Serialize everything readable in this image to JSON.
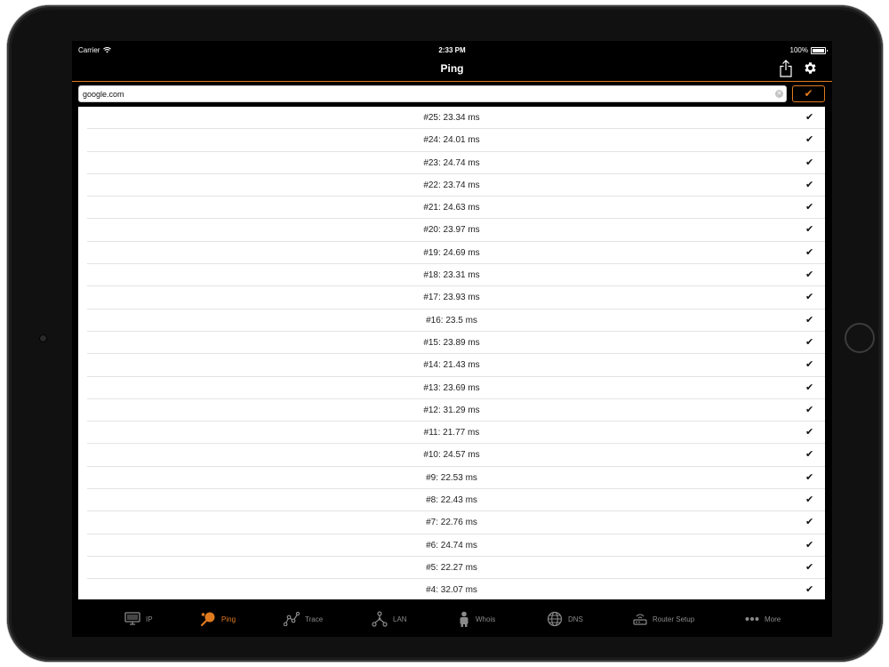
{
  "status": {
    "carrier": "Carrier",
    "time": "2:33 PM",
    "battery": "100%"
  },
  "nav": {
    "title": "Ping"
  },
  "search": {
    "value": "google.com"
  },
  "go_button": {
    "label": "✔"
  },
  "results": [
    {
      "label": "#25: 23.34 ms",
      "check": "✔"
    },
    {
      "label": "#24: 24.01 ms",
      "check": "✔"
    },
    {
      "label": "#23: 24.74 ms",
      "check": "✔"
    },
    {
      "label": "#22: 23.74 ms",
      "check": "✔"
    },
    {
      "label": "#21: 24.63 ms",
      "check": "✔"
    },
    {
      "label": "#20: 23.97 ms",
      "check": "✔"
    },
    {
      "label": "#19: 24.69 ms",
      "check": "✔"
    },
    {
      "label": "#18: 23.31 ms",
      "check": "✔"
    },
    {
      "label": "#17: 23.93 ms",
      "check": "✔"
    },
    {
      "label": "#16: 23.5 ms",
      "check": "✔"
    },
    {
      "label": "#15: 23.89 ms",
      "check": "✔"
    },
    {
      "label": "#14: 21.43 ms",
      "check": "✔"
    },
    {
      "label": "#13: 23.69 ms",
      "check": "✔"
    },
    {
      "label": "#12: 31.29 ms",
      "check": "✔"
    },
    {
      "label": "#11: 21.77 ms",
      "check": "✔"
    },
    {
      "label": "#10: 24.57 ms",
      "check": "✔"
    },
    {
      "label": "#9: 22.53 ms",
      "check": "✔"
    },
    {
      "label": "#8: 22.43 ms",
      "check": "✔"
    },
    {
      "label": "#7: 22.76 ms",
      "check": "✔"
    },
    {
      "label": "#6: 24.74 ms",
      "check": "✔"
    },
    {
      "label": "#5: 22.27 ms",
      "check": "✔"
    },
    {
      "label": "#4: 32.07 ms",
      "check": "✔"
    }
  ],
  "tabs": [
    {
      "label": "IP",
      "icon": "monitor-icon",
      "active": false
    },
    {
      "label": "Ping",
      "icon": "ping-pong-icon",
      "active": true
    },
    {
      "label": "Trace",
      "icon": "trace-route-icon",
      "active": false
    },
    {
      "label": "LAN",
      "icon": "lan-network-icon",
      "active": false
    },
    {
      "label": "Whois",
      "icon": "whois-person-icon",
      "active": false
    },
    {
      "label": "DNS",
      "icon": "globe-icon",
      "active": false
    },
    {
      "label": "Router Setup",
      "icon": "router-icon",
      "active": false
    },
    {
      "label": "More",
      "icon": "more-dots-icon",
      "active": false
    }
  ],
  "colors": {
    "accent": "#e07a1f",
    "inactive_tab": "#8a8a8a",
    "background": "#000000"
  }
}
